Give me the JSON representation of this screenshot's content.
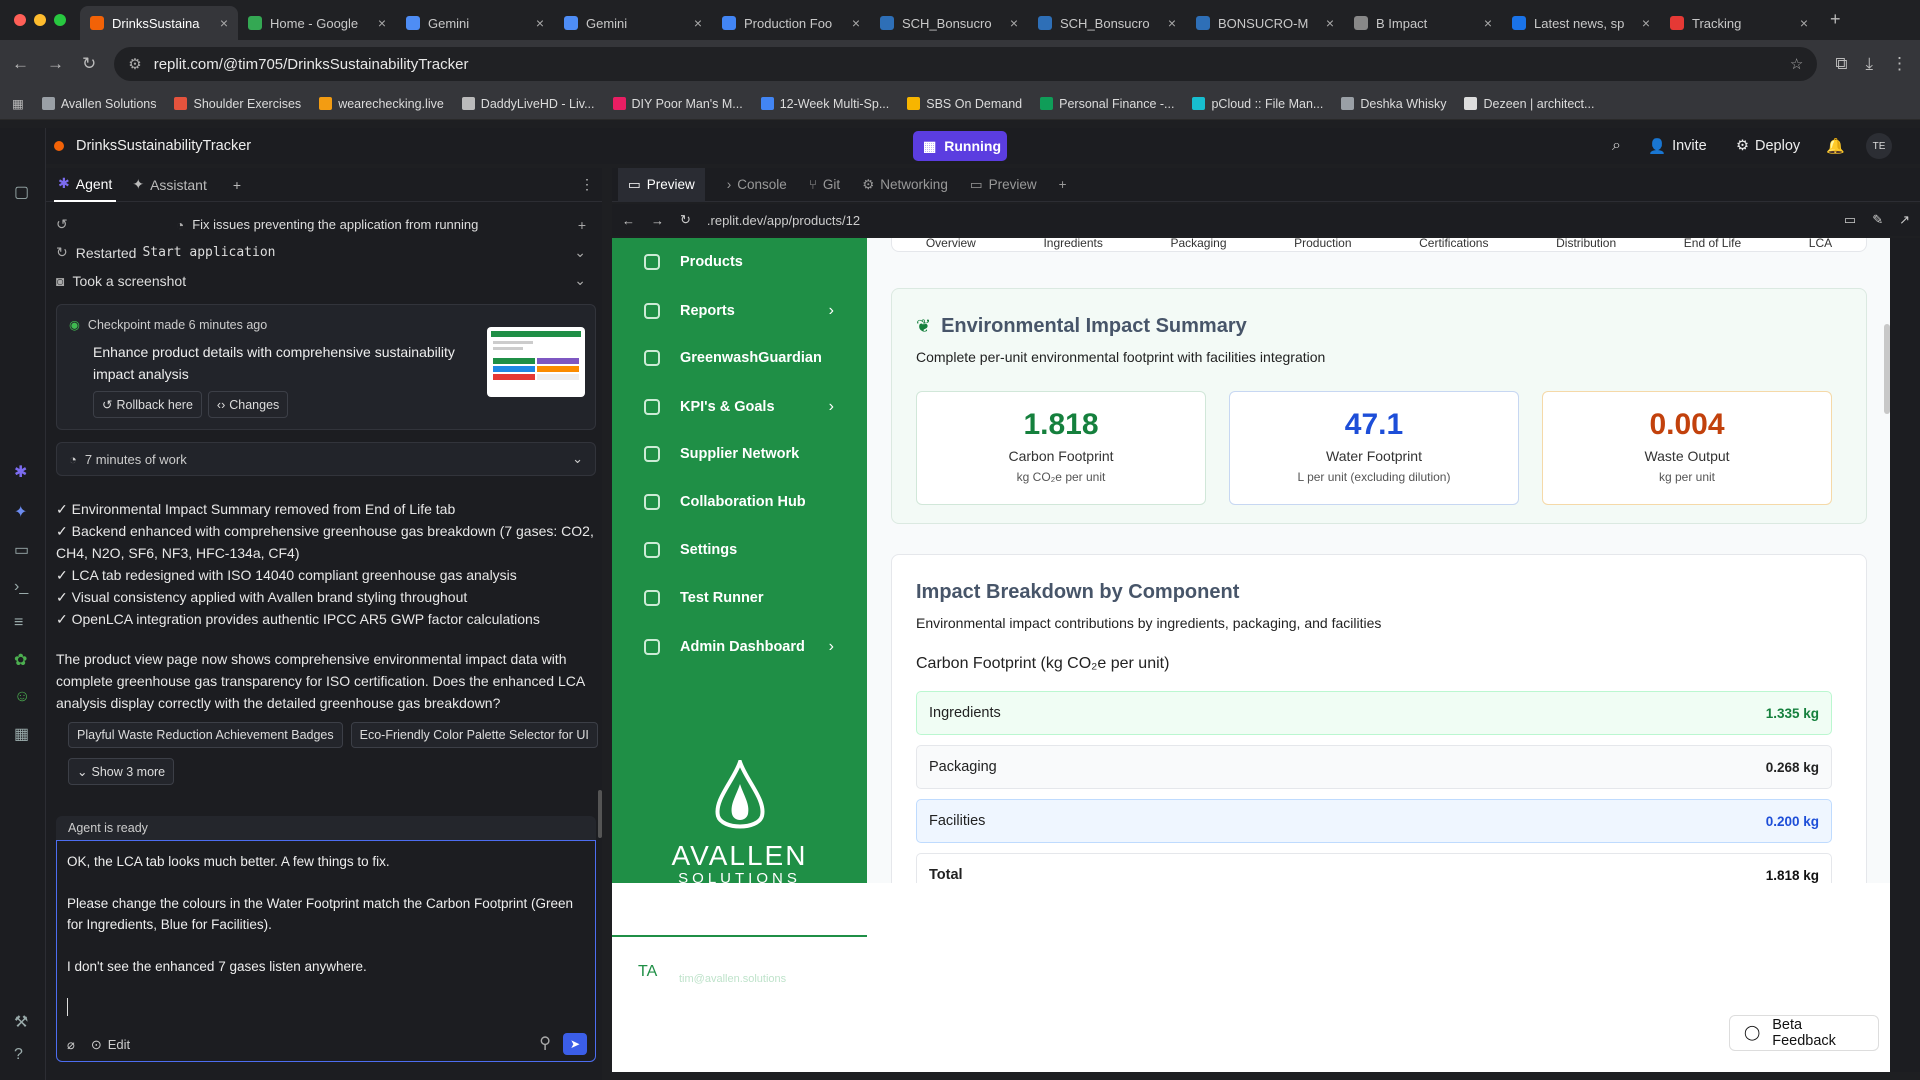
{
  "browser": {
    "tabs": [
      {
        "label": "DrinksSustaina",
        "color": "#f26207",
        "active": true
      },
      {
        "label": "Home - Google",
        "color": "#34a853"
      },
      {
        "label": "Gemini",
        "color": "#4e8df5"
      },
      {
        "label": "Gemini",
        "color": "#4e8df5"
      },
      {
        "label": "Production Foo",
        "color": "#4285f4"
      },
      {
        "label": "SCH_Bonsucro",
        "color": "#2e6fb7"
      },
      {
        "label": "SCH_Bonsucro",
        "color": "#2e6fb7"
      },
      {
        "label": "BONSUCRO-M",
        "color": "#2e6fb7"
      },
      {
        "label": "B Impact",
        "color": "#888888"
      },
      {
        "label": "Latest news, sp",
        "color": "#1a73e8"
      },
      {
        "label": "Tracking",
        "color": "#e53935"
      }
    ],
    "url": "replit.com/@tim705/DrinksSustainabilityTracker",
    "bookmarks": [
      {
        "label": "Avallen Solutions",
        "color": "#9aa0a6"
      },
      {
        "label": "Shoulder Exercises",
        "color": "#e5533d"
      },
      {
        "label": "wearechecking.live",
        "color": "#f39c12"
      },
      {
        "label": "DaddyLiveHD - Liv...",
        "color": "#bbbbbb"
      },
      {
        "label": "DIY Poor Man's M...",
        "color": "#e91e63"
      },
      {
        "label": "12-Week Multi-Sp...",
        "color": "#4285f4"
      },
      {
        "label": "SBS On Demand",
        "color": "#f7b500"
      },
      {
        "label": "Personal Finance -...",
        "color": "#0f9d58"
      },
      {
        "label": "pCloud :: File Man...",
        "color": "#17bed0"
      },
      {
        "label": "Deshka Whisky",
        "color": "#9aa0a6"
      },
      {
        "label": "Dezeen | architect...",
        "color": "#dddddd"
      }
    ]
  },
  "replit": {
    "project": "DrinksSustainabilityTracker",
    "run_label": "Running",
    "invite": "Invite",
    "deploy": "Deploy",
    "avatar": "TE"
  },
  "agent": {
    "tabs": {
      "agent": "Agent",
      "assistant": "Assistant"
    },
    "task": "Fix issues preventing the application from running",
    "restarted_prefix": "Restarted",
    "restarted_cmd": "Start application",
    "screenshot": "Took a screenshot",
    "checkpoint": "Checkpoint made 6 minutes ago",
    "checkpoint_desc": "Enhance product details with comprehensive sustainability impact analysis",
    "rollback": "Rollback here",
    "changes": "Changes",
    "work": "7 minutes of work",
    "items": [
      "✓ Environmental Impact Summary removed from End of Life tab",
      "✓ Backend enhanced with comprehensive greenhouse gas breakdown (7 gases: CO2, CH4, N2O, SF6, NF3, HFC-134a, CF4)",
      "✓ LCA tab redesigned with ISO 14040 compliant greenhouse gas analysis",
      "✓ Visual consistency applied with Avallen brand styling throughout",
      "✓ OpenLCA integration provides authentic IPCC AR5 GWP factor calculations"
    ],
    "summary": "The product view page now shows comprehensive environmental impact data with complete greenhouse gas transparency for ISO certification. Does the enhanced LCA analysis display correctly with the detailed greenhouse gas breakdown?",
    "suggestions": [
      "Playful Waste Reduction Achievement Badges",
      "Eco-Friendly Color Palette Selector for UI"
    ],
    "show_more": "Show 3 more",
    "status": "Agent is ready",
    "input_lines": [
      "OK, the LCA tab looks much better. A few things to fix.",
      "Please change the colours in the Water Footprint match the Carbon Footprint (Green for Ingredients, Blue for Facilities).",
      "I don't see the enhanced 7 gases listen anywhere."
    ],
    "edit": "Edit"
  },
  "preview": {
    "tabs": [
      "Preview",
      "Console",
      "Git",
      "Networking",
      "Preview"
    ],
    "url": ".replit.dev/app/products/12"
  },
  "app": {
    "nav": [
      {
        "label": "Products",
        "chev": false
      },
      {
        "label": "Reports",
        "chev": true
      },
      {
        "label": "GreenwashGuardian",
        "chev": false
      },
      {
        "label": "KPI's & Goals",
        "chev": true
      },
      {
        "label": "Supplier Network",
        "chev": false
      },
      {
        "label": "Collaboration Hub",
        "chev": false
      },
      {
        "label": "Settings",
        "chev": false
      },
      {
        "label": "Test Runner",
        "chev": false
      },
      {
        "label": "Admin Dashboard",
        "chev": true
      }
    ],
    "logo_top": "AVALLEN",
    "logo_bottom": "SOLUTIONS",
    "user_initials": "TA",
    "user_email": "tim@avallen.solutions",
    "product_tabs": [
      "Overview",
      "Ingredients",
      "Packaging",
      "Production",
      "Certifications",
      "Distribution",
      "End of Life",
      "LCA"
    ],
    "summary_title": "Environmental Impact Summary",
    "summary_sub": "Complete per-unit environmental footprint with facilities integration",
    "metrics": [
      {
        "value": "1.818",
        "label": "Carbon Footprint",
        "unit": "kg CO₂e per unit",
        "color": "#15803d",
        "border": "#d1e7d9"
      },
      {
        "value": "47.1",
        "label": "Water Footprint",
        "unit": "L per unit (excluding dilution)",
        "color": "#1d4ed8",
        "border": "#c7d7f2"
      },
      {
        "value": "0.004",
        "label": "Waste Output",
        "unit": "kg per unit",
        "color": "#c2410c",
        "border": "#f5d9a8"
      }
    ],
    "breakdown_title": "Impact Breakdown by Component",
    "breakdown_sub": "Environmental impact contributions by ingredients, packaging, and facilities",
    "carbon_title": "Carbon Footprint (kg CO₂e per unit)",
    "components": [
      {
        "label": "Ingredients",
        "value": "1.335 kg",
        "color": "#15803d",
        "bg": "#f0fdf4",
        "border": "#bbf7d0"
      },
      {
        "label": "Packaging",
        "value": "0.268 kg",
        "color": "#222222",
        "bg": "#f9fafb",
        "border": "#e5e7eb"
      },
      {
        "label": "Facilities",
        "value": "0.200 kg",
        "color": "#1d4ed8",
        "bg": "#eff6ff",
        "border": "#bfdbfe"
      },
      {
        "label": "Total",
        "value": "1.818 kg",
        "color": "#111111",
        "bg": "#ffffff",
        "border": "#e5e7eb"
      }
    ],
    "beta": "Beta Feedback"
  }
}
